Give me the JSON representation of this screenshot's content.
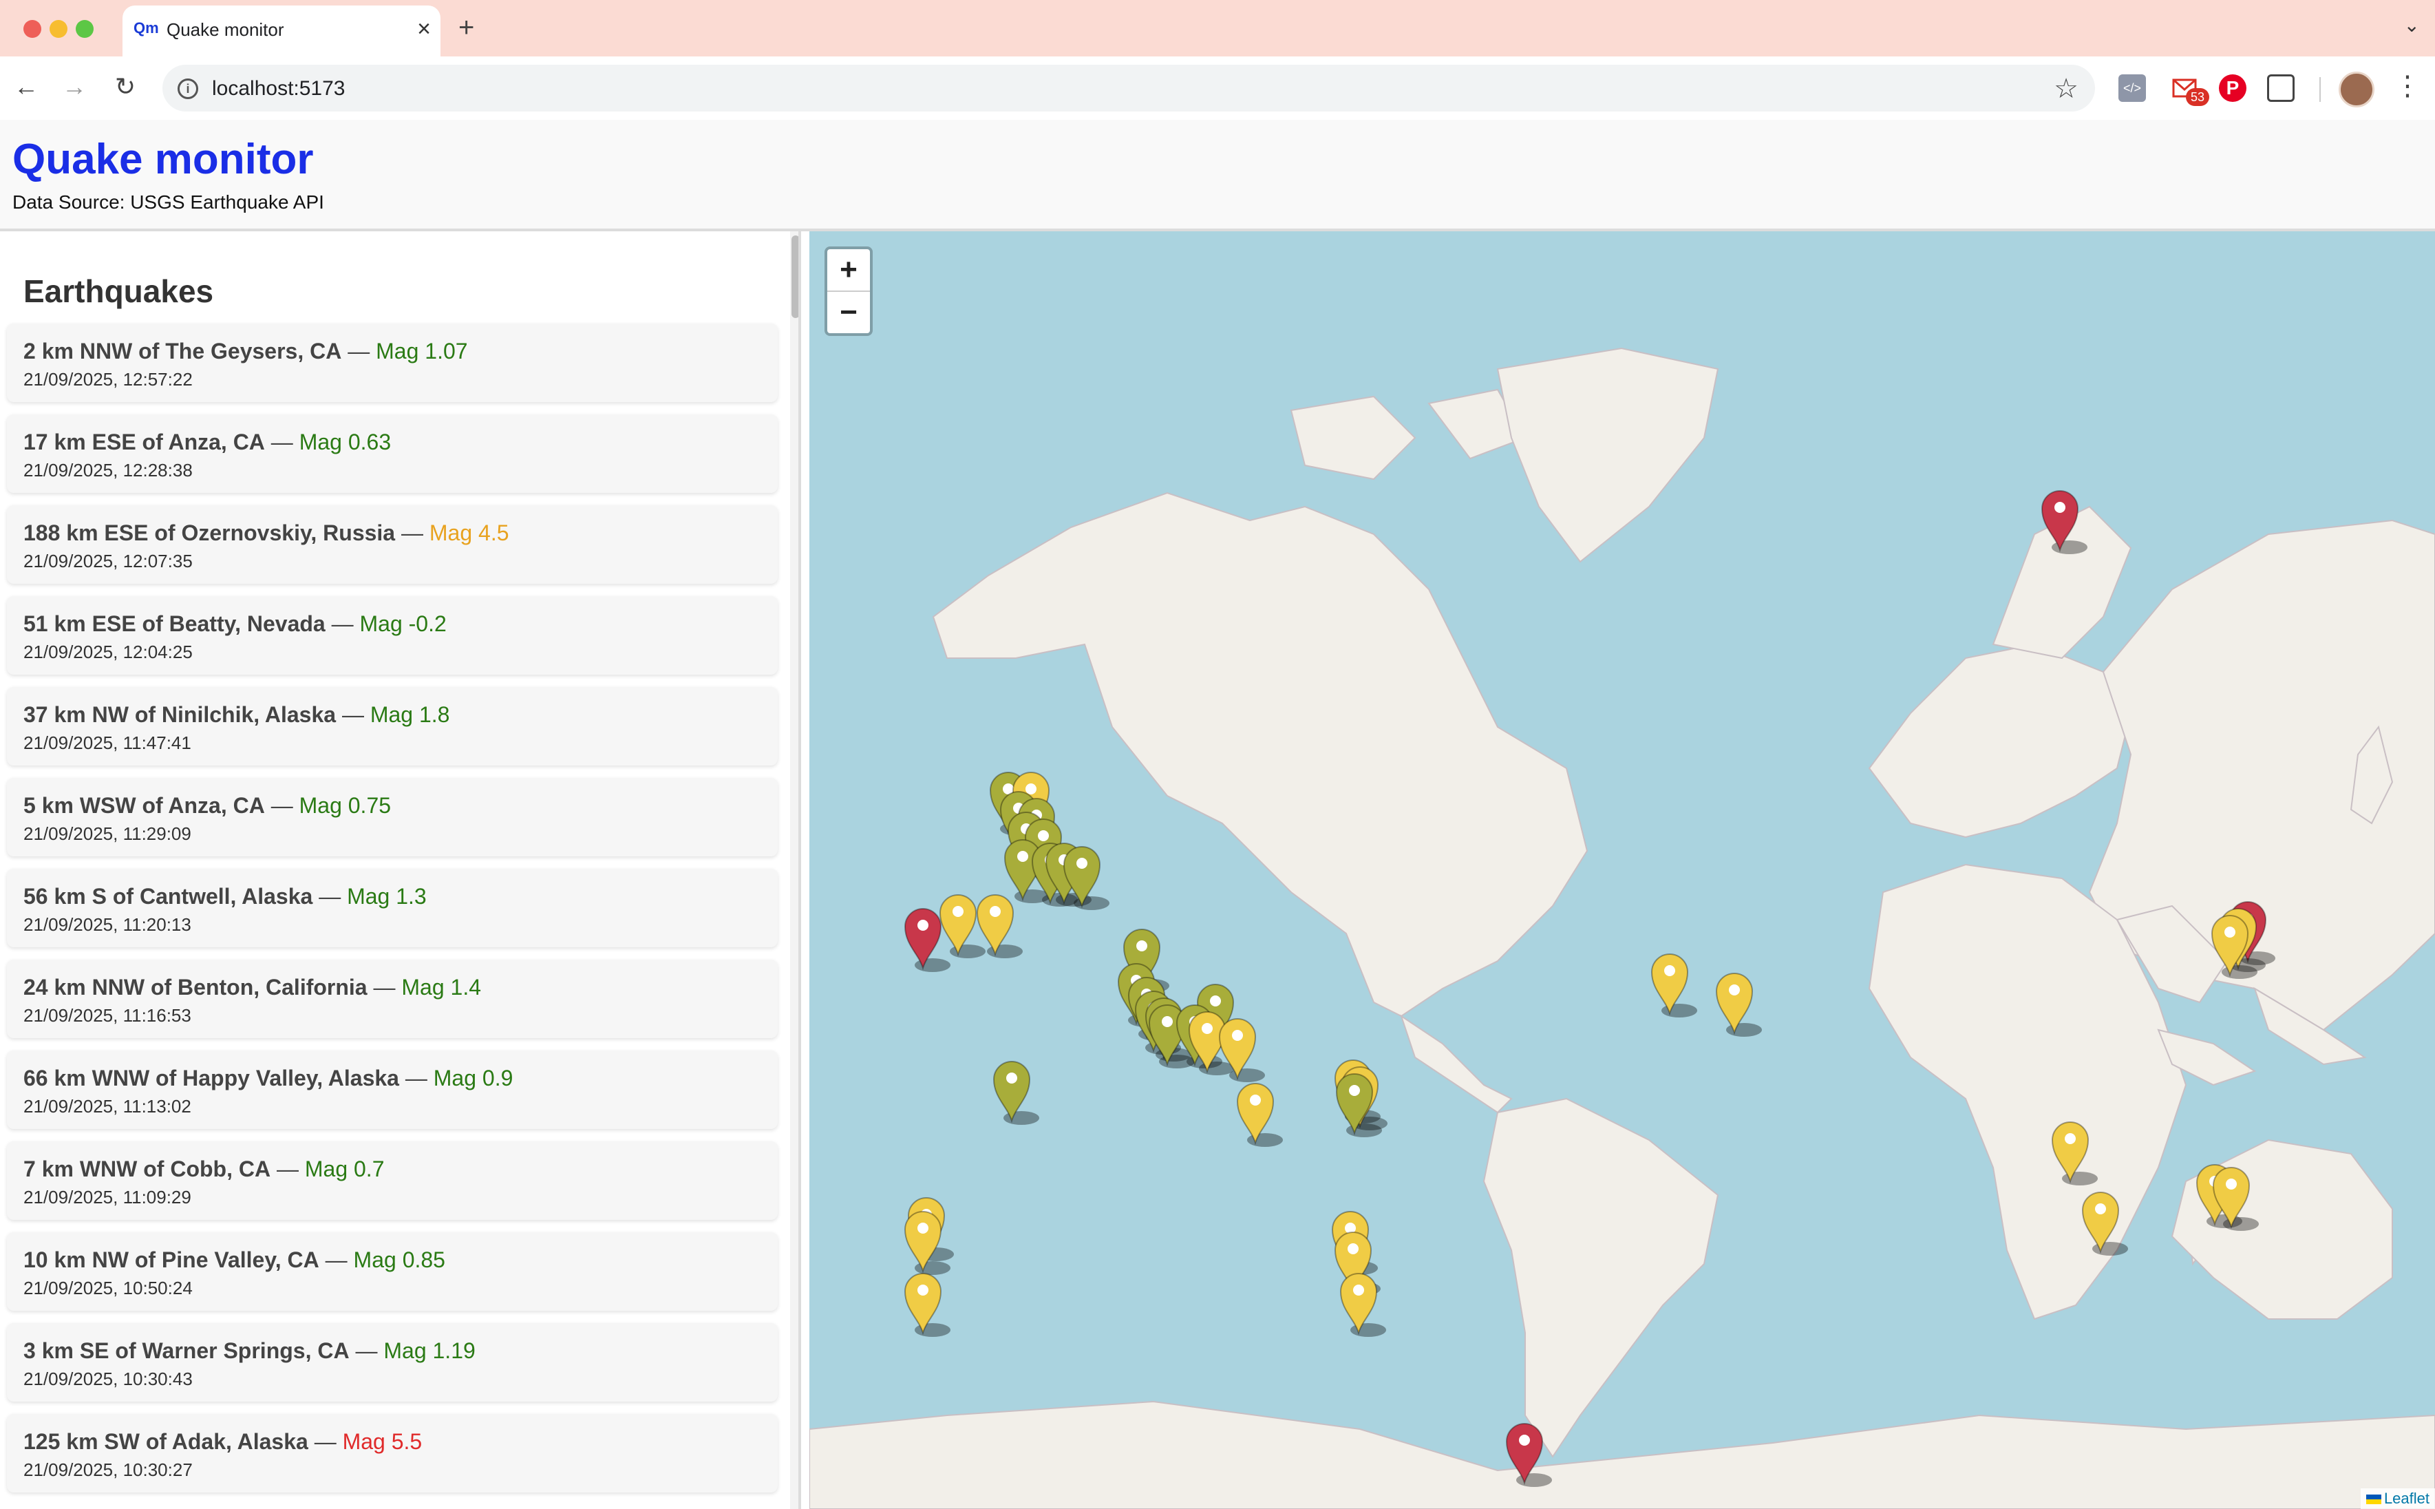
{
  "browser": {
    "tab_favicon": "Qm",
    "tab_title": "Quake monitor",
    "url": "localhost:5173",
    "mail_badge": "53"
  },
  "app": {
    "title": "Quake monitor",
    "source": "Data Source: USGS Earthquake API"
  },
  "sidebar": {
    "title": "Earthquakes",
    "items": [
      {
        "place": "2 km NNW of The Geysers, CA",
        "mag": "Mag 1.07",
        "level": "low",
        "time": "21/09/2025, 12:57:22"
      },
      {
        "place": "17 km ESE of Anza, CA",
        "mag": "Mag 0.63",
        "level": "low",
        "time": "21/09/2025, 12:28:38"
      },
      {
        "place": "188 km ESE of Ozernovskiy, Russia",
        "mag": "Mag 4.5",
        "level": "med",
        "time": "21/09/2025, 12:07:35"
      },
      {
        "place": "51 km ESE of Beatty, Nevada",
        "mag": "Mag -0.2",
        "level": "low",
        "time": "21/09/2025, 12:04:25"
      },
      {
        "place": "37 km NW of Ninilchik, Alaska",
        "mag": "Mag 1.8",
        "level": "low",
        "time": "21/09/2025, 11:47:41"
      },
      {
        "place": "5 km WSW of Anza, CA",
        "mag": "Mag 0.75",
        "level": "low",
        "time": "21/09/2025, 11:29:09"
      },
      {
        "place": "56 km S of Cantwell, Alaska",
        "mag": "Mag 1.3",
        "level": "low",
        "time": "21/09/2025, 11:20:13"
      },
      {
        "place": "24 km NNW of Benton, California",
        "mag": "Mag 1.4",
        "level": "low",
        "time": "21/09/2025, 11:16:53"
      },
      {
        "place": "66 km WNW of Happy Valley, Alaska",
        "mag": "Mag 0.9",
        "level": "low",
        "time": "21/09/2025, 11:13:02"
      },
      {
        "place": "7 km WNW of Cobb, CA",
        "mag": "Mag 0.7",
        "level": "low",
        "time": "21/09/2025, 11:09:29"
      },
      {
        "place": "10 km NW of Pine Valley, CA",
        "mag": "Mag 0.85",
        "level": "low",
        "time": "21/09/2025, 10:50:24"
      },
      {
        "place": "3 km SE of Warner Springs, CA",
        "mag": "Mag 1.19",
        "level": "low",
        "time": "21/09/2025, 10:30:43"
      },
      {
        "place": "125 km SW of Adak, Alaska",
        "mag": "Mag 5.5",
        "level": "high",
        "time": "21/09/2025, 10:30:27"
      }
    ]
  },
  "map": {
    "zoom_in": "+",
    "zoom_out": "−",
    "attribution": "Leaflet",
    "colors": {
      "ocean": "#aad3df",
      "land": "#f2efe9",
      "pin_low": "#a8ad3a",
      "pin_med": "#f0cc45",
      "pin_high": "#c8374a"
    }
  },
  "colors": {
    "title": "#1a2ee6",
    "mag_low": "#2a7a14",
    "mag_med": "#e8a21f",
    "mag_high": "#e02a2a"
  }
}
